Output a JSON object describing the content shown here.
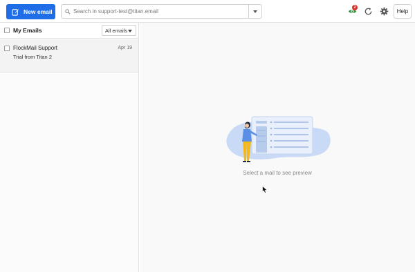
{
  "toolbar": {
    "new_email_label": "New email",
    "search_placeholder": "Search in support-test@titan.email",
    "notification_count": "2",
    "help_label": "Help",
    "accent_color": "#1f6ee8"
  },
  "mail_list": {
    "header_title": "My Emails",
    "filter_selected": "All emails",
    "items": [
      {
        "sender": "FlockMail Support",
        "date": "Apr 19",
        "subject": "Trial from Titan 2"
      }
    ]
  },
  "preview": {
    "empty_text": "Select a mail to see preview"
  },
  "icons": {
    "new_email": "pencil-square-icon",
    "search": "magnifier-icon",
    "notifications": "eye-notification-icon",
    "refresh": "refresh-icon",
    "settings": "gear-icon"
  }
}
